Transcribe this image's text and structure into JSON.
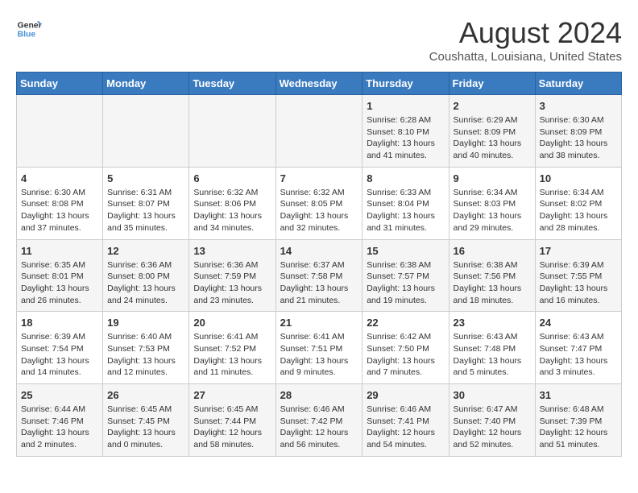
{
  "logo": {
    "line1": "General",
    "line2": "Blue"
  },
  "title": "August 2024",
  "location": "Coushatta, Louisiana, United States",
  "weekdays": [
    "Sunday",
    "Monday",
    "Tuesday",
    "Wednesday",
    "Thursday",
    "Friday",
    "Saturday"
  ],
  "weeks": [
    [
      {
        "day": "",
        "info": ""
      },
      {
        "day": "",
        "info": ""
      },
      {
        "day": "",
        "info": ""
      },
      {
        "day": "",
        "info": ""
      },
      {
        "day": "1",
        "info": "Sunrise: 6:28 AM\nSunset: 8:10 PM\nDaylight: 13 hours\nand 41 minutes."
      },
      {
        "day": "2",
        "info": "Sunrise: 6:29 AM\nSunset: 8:09 PM\nDaylight: 13 hours\nand 40 minutes."
      },
      {
        "day": "3",
        "info": "Sunrise: 6:30 AM\nSunset: 8:09 PM\nDaylight: 13 hours\nand 38 minutes."
      }
    ],
    [
      {
        "day": "4",
        "info": "Sunrise: 6:30 AM\nSunset: 8:08 PM\nDaylight: 13 hours\nand 37 minutes."
      },
      {
        "day": "5",
        "info": "Sunrise: 6:31 AM\nSunset: 8:07 PM\nDaylight: 13 hours\nand 35 minutes."
      },
      {
        "day": "6",
        "info": "Sunrise: 6:32 AM\nSunset: 8:06 PM\nDaylight: 13 hours\nand 34 minutes."
      },
      {
        "day": "7",
        "info": "Sunrise: 6:32 AM\nSunset: 8:05 PM\nDaylight: 13 hours\nand 32 minutes."
      },
      {
        "day": "8",
        "info": "Sunrise: 6:33 AM\nSunset: 8:04 PM\nDaylight: 13 hours\nand 31 minutes."
      },
      {
        "day": "9",
        "info": "Sunrise: 6:34 AM\nSunset: 8:03 PM\nDaylight: 13 hours\nand 29 minutes."
      },
      {
        "day": "10",
        "info": "Sunrise: 6:34 AM\nSunset: 8:02 PM\nDaylight: 13 hours\nand 28 minutes."
      }
    ],
    [
      {
        "day": "11",
        "info": "Sunrise: 6:35 AM\nSunset: 8:01 PM\nDaylight: 13 hours\nand 26 minutes."
      },
      {
        "day": "12",
        "info": "Sunrise: 6:36 AM\nSunset: 8:00 PM\nDaylight: 13 hours\nand 24 minutes."
      },
      {
        "day": "13",
        "info": "Sunrise: 6:36 AM\nSunset: 7:59 PM\nDaylight: 13 hours\nand 23 minutes."
      },
      {
        "day": "14",
        "info": "Sunrise: 6:37 AM\nSunset: 7:58 PM\nDaylight: 13 hours\nand 21 minutes."
      },
      {
        "day": "15",
        "info": "Sunrise: 6:38 AM\nSunset: 7:57 PM\nDaylight: 13 hours\nand 19 minutes."
      },
      {
        "day": "16",
        "info": "Sunrise: 6:38 AM\nSunset: 7:56 PM\nDaylight: 13 hours\nand 18 minutes."
      },
      {
        "day": "17",
        "info": "Sunrise: 6:39 AM\nSunset: 7:55 PM\nDaylight: 13 hours\nand 16 minutes."
      }
    ],
    [
      {
        "day": "18",
        "info": "Sunrise: 6:39 AM\nSunset: 7:54 PM\nDaylight: 13 hours\nand 14 minutes."
      },
      {
        "day": "19",
        "info": "Sunrise: 6:40 AM\nSunset: 7:53 PM\nDaylight: 13 hours\nand 12 minutes."
      },
      {
        "day": "20",
        "info": "Sunrise: 6:41 AM\nSunset: 7:52 PM\nDaylight: 13 hours\nand 11 minutes."
      },
      {
        "day": "21",
        "info": "Sunrise: 6:41 AM\nSunset: 7:51 PM\nDaylight: 13 hours\nand 9 minutes."
      },
      {
        "day": "22",
        "info": "Sunrise: 6:42 AM\nSunset: 7:50 PM\nDaylight: 13 hours\nand 7 minutes."
      },
      {
        "day": "23",
        "info": "Sunrise: 6:43 AM\nSunset: 7:48 PM\nDaylight: 13 hours\nand 5 minutes."
      },
      {
        "day": "24",
        "info": "Sunrise: 6:43 AM\nSunset: 7:47 PM\nDaylight: 13 hours\nand 3 minutes."
      }
    ],
    [
      {
        "day": "25",
        "info": "Sunrise: 6:44 AM\nSunset: 7:46 PM\nDaylight: 13 hours\nand 2 minutes."
      },
      {
        "day": "26",
        "info": "Sunrise: 6:45 AM\nSunset: 7:45 PM\nDaylight: 13 hours\nand 0 minutes."
      },
      {
        "day": "27",
        "info": "Sunrise: 6:45 AM\nSunset: 7:44 PM\nDaylight: 12 hours\nand 58 minutes."
      },
      {
        "day": "28",
        "info": "Sunrise: 6:46 AM\nSunset: 7:42 PM\nDaylight: 12 hours\nand 56 minutes."
      },
      {
        "day": "29",
        "info": "Sunrise: 6:46 AM\nSunset: 7:41 PM\nDaylight: 12 hours\nand 54 minutes."
      },
      {
        "day": "30",
        "info": "Sunrise: 6:47 AM\nSunset: 7:40 PM\nDaylight: 12 hours\nand 52 minutes."
      },
      {
        "day": "31",
        "info": "Sunrise: 6:48 AM\nSunset: 7:39 PM\nDaylight: 12 hours\nand 51 minutes."
      }
    ]
  ]
}
